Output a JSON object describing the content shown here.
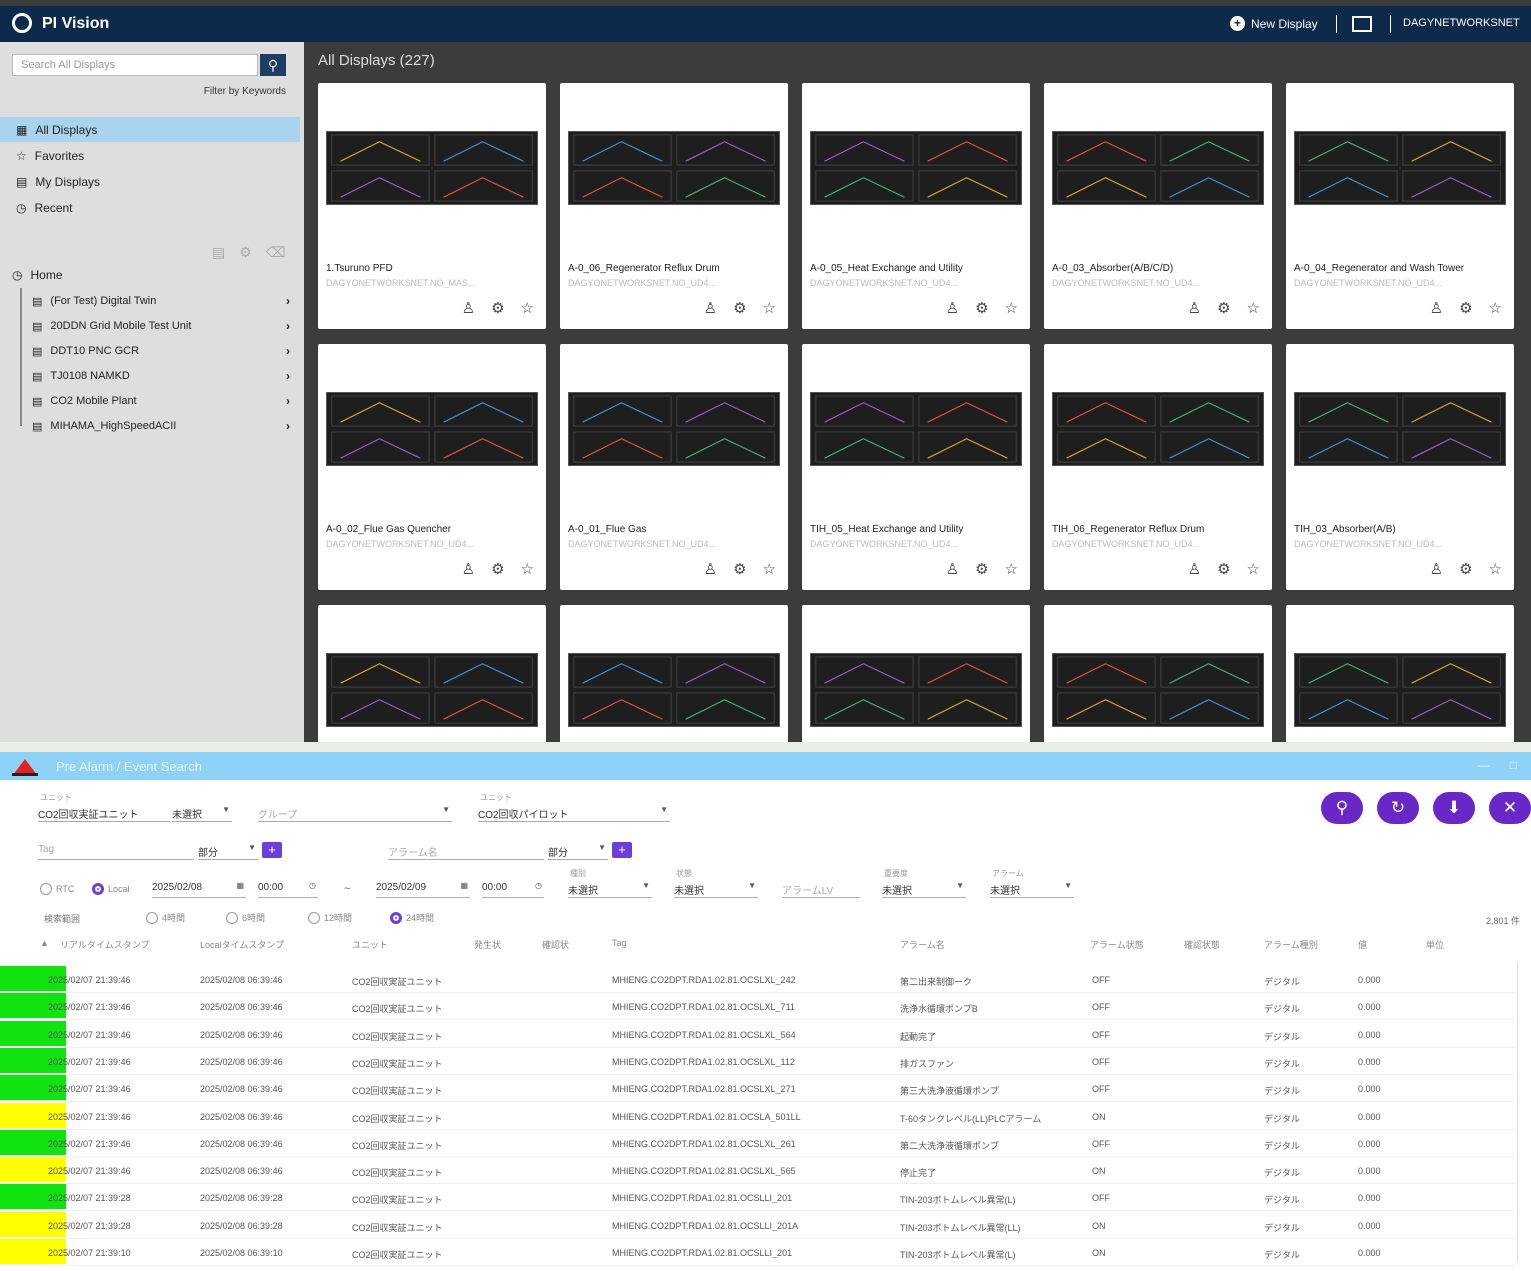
{
  "pv": {
    "brand": "PI Vision",
    "new_display": "New Display",
    "user": "DAGYNETWORKSNET",
    "search_placeholder": "Search All Displays",
    "filter_keywords": "Filter by Keywords",
    "nav": [
      "All Displays",
      "Favorites",
      "My Displays",
      "Recent"
    ],
    "home": "Home",
    "folders": [
      "(For Test) Digital Twin",
      "20DDN Grid Mobile Test Unit",
      "DDT10 PNC GCR",
      "TJ0108 NAMKD",
      "CO2 Mobile Plant",
      "MIHAMA_HighSpeedACII"
    ],
    "page_title": "All Displays (227)",
    "cards": [
      {
        "name": "1.Tsuruno PFD",
        "sub": "DAGYONETWORKSNET.NO_MAS..."
      },
      {
        "name": "A-0_06_Regenerator Reflux Drum",
        "sub": "DAGYONETWORKSNET.NO_UD4..."
      },
      {
        "name": "A-0_05_Heat Exchange and Utility",
        "sub": "DAGYONETWORKSNET.NO_UD4..."
      },
      {
        "name": "A-0_03_Absorber(A/B/C/D)",
        "sub": "DAGYONETWORKSNET.NO_UD4..."
      },
      {
        "name": "A-0_04_Regenerator and Wash Tower",
        "sub": "DAGYONETWORKSNET.NO_UD4..."
      },
      {
        "name": "A-0_02_Flue Gas Quencher",
        "sub": "DAGYONETWORKSNET.NO_UD4..."
      },
      {
        "name": "A-0_01_Flue Gas",
        "sub": "DAGYONETWORKSNET.NO_UD4..."
      },
      {
        "name": "TIH_05_Heat Exchange and Utility",
        "sub": "DAGYONETWORKSNET.NO_UD4..."
      },
      {
        "name": "TIH_06_Regenerator Reflux Drum",
        "sub": "DAGYONETWORKSNET.NO_UD4..."
      },
      {
        "name": "TIH_03_Absorber(A/B)",
        "sub": "DAGYONETWORKSNET.NO_UD4..."
      },
      {
        "name": "",
        "sub": ""
      },
      {
        "name": "",
        "sub": ""
      },
      {
        "name": "",
        "sub": ""
      },
      {
        "name": "",
        "sub": ""
      },
      {
        "name": "",
        "sub": ""
      }
    ]
  },
  "ae": {
    "title": "Pre Alarm / Event Search",
    "unit_label": "ユニット",
    "unit_value": "CO2回収実証ユニット",
    "status_value": "未選択",
    "group_ph": "グループ",
    "unit2_label": "ユニット",
    "unit2_value": "CO2回収パイロット",
    "tag_ph": "Tag",
    "tag_match": "部分",
    "alarm_ph": "アラーム名",
    "alarm_match": "部分",
    "rtc": "RTC",
    "local": "Local",
    "start_date": "2025/02/08",
    "start_time": "00:00",
    "tilde": "~",
    "end_date": "2025/02/09",
    "end_time": "00:00",
    "f1_label": "種別",
    "f1_value": "未選択",
    "f2_label": "状態",
    "f2_value": "未選択",
    "alarm_level_ph": "アラームLV",
    "f3_label": "重要度",
    "f3_value": "未選択",
    "f4_label": "アラーム",
    "f4_value": "未選択",
    "range_label": "検索範囲",
    "ranges": [
      "4時間",
      "6時間",
      "12時間",
      "24時間"
    ],
    "count": "2,801 件",
    "headers": [
      "リアルタイムスタンプ",
      "Localタイムスタンプ",
      "ユニット",
      "発生状",
      "確認状",
      "Tag",
      "アラーム名",
      "アラーム状態",
      "確認状態",
      "アラーム種別",
      "値",
      "単位"
    ],
    "rows": [
      {
        "ts": "2025/02/07 21:39:46",
        "lts": "2025/02/08 06:39:46",
        "unit": "CO2回収実証ユニット",
        "color": "#11e311",
        "tag": "MHIENG.CO2DPT.RDA1.02.81.OCSLXL_242",
        "name": "第二出来制御ーク",
        "state": "OFF",
        "kind": "デジタル",
        "val": "0.000"
      },
      {
        "ts": "2025/02/07 21:39:46",
        "lts": "2025/02/08 06:39:46",
        "unit": "CO2回収実証ユニット",
        "color": "#11e311",
        "tag": "MHIENG.CO2DPT.RDA1.02.81.OCSLXL_711",
        "name": "洗浄水循環ポンプB",
        "state": "OFF",
        "kind": "デジタル",
        "val": "0.000"
      },
      {
        "ts": "2025/02/07 21:39:46",
        "lts": "2025/02/08 06:39:46",
        "unit": "CO2回収実証ユニット",
        "color": "#11e311",
        "tag": "MHIENG.CO2DPT.RDA1.02.81.OCSLXL_564",
        "name": "起動完了",
        "state": "OFF",
        "kind": "デジタル",
        "val": "0.000"
      },
      {
        "ts": "2025/02/07 21:39:46",
        "lts": "2025/02/08 06:39:46",
        "unit": "CO2回収実証ユニット",
        "color": "#11e311",
        "tag": "MHIENG.CO2DPT.RDA1.02.81.OCSLXL_112",
        "name": "排ガスファン",
        "state": "OFF",
        "kind": "デジタル",
        "val": "0.000"
      },
      {
        "ts": "2025/02/07 21:39:46",
        "lts": "2025/02/08 06:39:46",
        "unit": "CO2回収実証ユニット",
        "color": "#11e311",
        "tag": "MHIENG.CO2DPT.RDA1.02.81.OCSLXL_271",
        "name": "第三大洗浄液循環ポンプ",
        "state": "OFF",
        "kind": "デジタル",
        "val": "0.000"
      },
      {
        "ts": "2025/02/07 21:39:46",
        "lts": "2025/02/08 06:39:46",
        "unit": "CO2回収実証ユニット",
        "color": "#ffff00",
        "tag": "MHIENG.CO2DPT.RDA1.02.81.OCSLA_501LL",
        "name": "T-60タンクレベル(LL)PLCアラーム",
        "state": "ON",
        "kind": "デジタル",
        "val": "0.000"
      },
      {
        "ts": "2025/02/07 21:39:46",
        "lts": "2025/02/08 06:39:46",
        "unit": "CO2回収実証ユニット",
        "color": "#11e311",
        "tag": "MHIENG.CO2DPT.RDA1.02.81.OCSLXL_261",
        "name": "第二大洗浄液循環ポンプ",
        "state": "OFF",
        "kind": "デジタル",
        "val": "0.000"
      },
      {
        "ts": "2025/02/07 21:39:46",
        "lts": "2025/02/08 06:39:46",
        "unit": "CO2回収実証ユニット",
        "color": "#ffff00",
        "tag": "MHIENG.CO2DPT.RDA1.02.81.OCSLXL_565",
        "name": "停止完了",
        "state": "ON",
        "kind": "デジタル",
        "val": "0.000"
      },
      {
        "ts": "2025/02/07 21:39:28",
        "lts": "2025/02/08 06:39:28",
        "unit": "CO2回収実証ユニット",
        "color": "#11e311",
        "tag": "MHIENG.CO2DPT.RDA1.02.81.OCSLLI_201",
        "name": "TIN-203ボトムレベル異常(L)",
        "state": "OFF",
        "kind": "デジタル",
        "val": "0.000"
      },
      {
        "ts": "2025/02/07 21:39:28",
        "lts": "2025/02/08 06:39:28",
        "unit": "CO2回収実証ユニット",
        "color": "#ffff00",
        "tag": "MHIENG.CO2DPT.RDA1.02.81.OCSLLI_201A",
        "name": "TIN-203ボトムレベル異常(LL)",
        "state": "ON",
        "kind": "デジタル",
        "val": "0.000"
      },
      {
        "ts": "2025/02/07 21:39:10",
        "lts": "2025/02/08 06:39:10",
        "unit": "CO2回収実証ユニット",
        "color": "#ffff00",
        "tag": "MHIENG.CO2DPT.RDA1.02.81.OCSLLI_201",
        "name": "TIN-203ボトムレベル異常(L)",
        "state": "ON",
        "kind": "デジタル",
        "val": "0.000"
      }
    ]
  }
}
